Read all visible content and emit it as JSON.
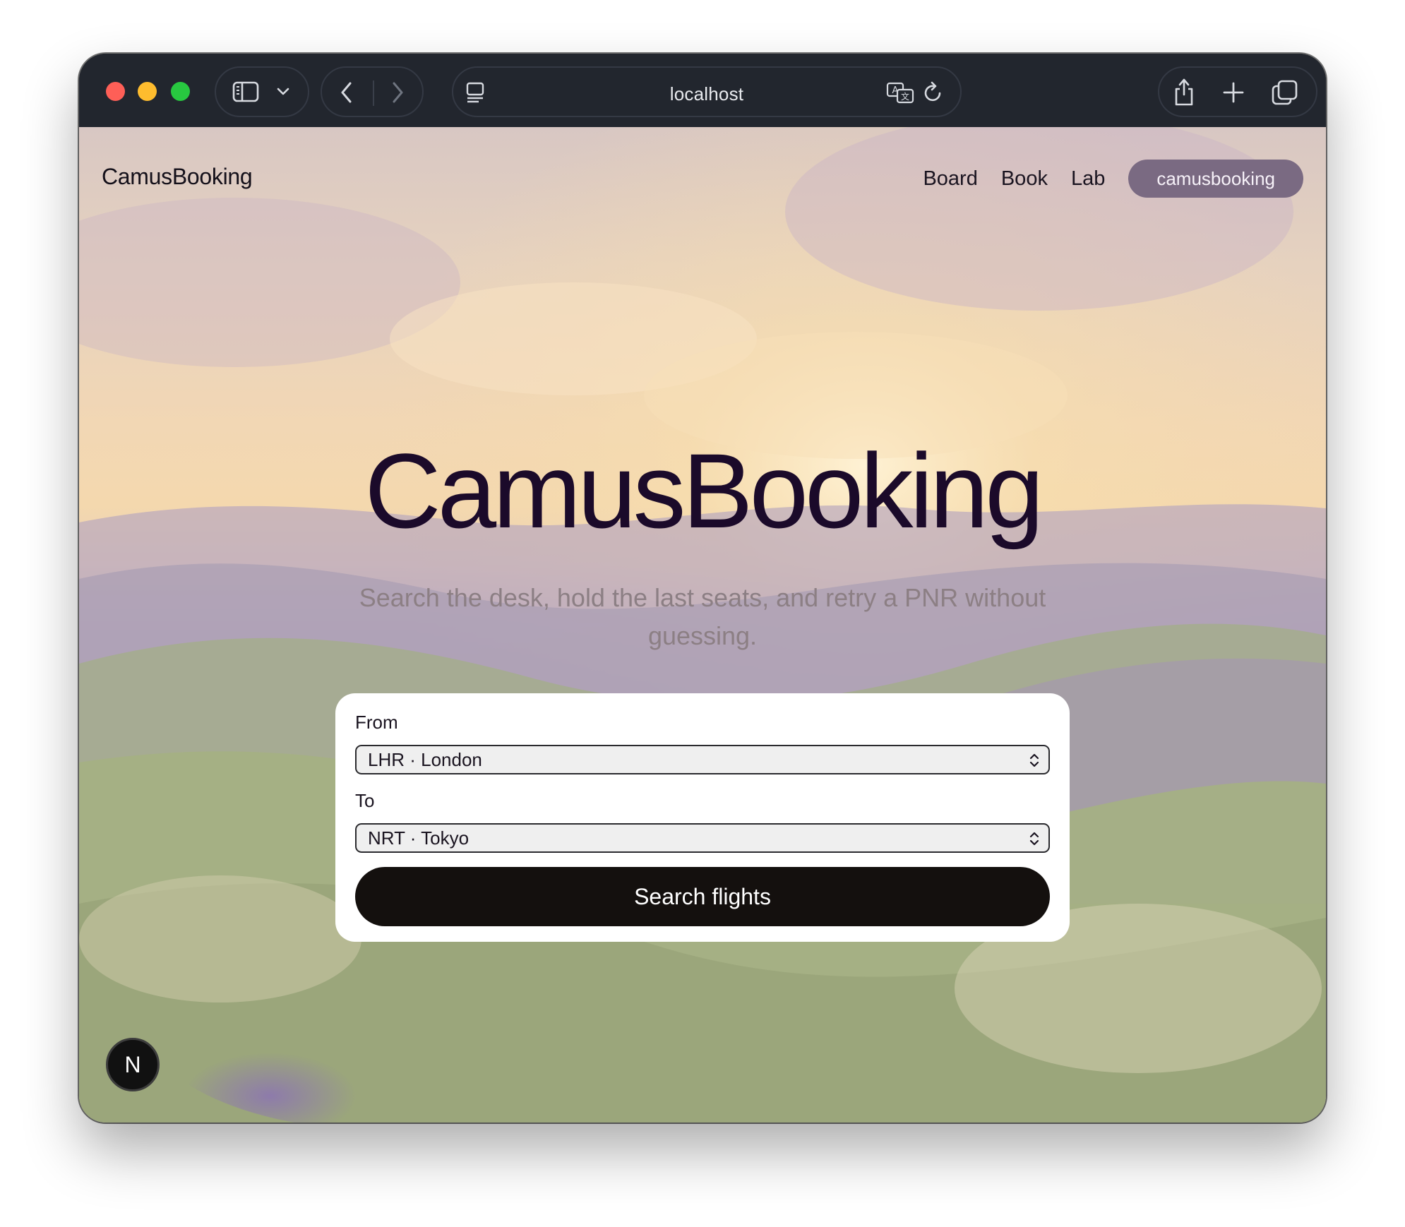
{
  "browser": {
    "url": "localhost"
  },
  "site": {
    "brand": "CamusBooking",
    "nav": [
      "Board",
      "Book",
      "Lab"
    ],
    "user": "camusbooking"
  },
  "hero": {
    "title": "CamusBooking",
    "subtitle": "Search the desk, hold the last seats, and retry a PNR without guessing."
  },
  "search_form": {
    "from_label": "From",
    "from_value": "LHR · London",
    "to_label": "To",
    "to_value": "NRT · Tokyo",
    "submit_label": "Search flights"
  },
  "dev_badge": "N",
  "colors": {
    "accent_pill": "#7a6a82",
    "button_dark": "#14100e",
    "title_text": "#1b0a2a"
  }
}
